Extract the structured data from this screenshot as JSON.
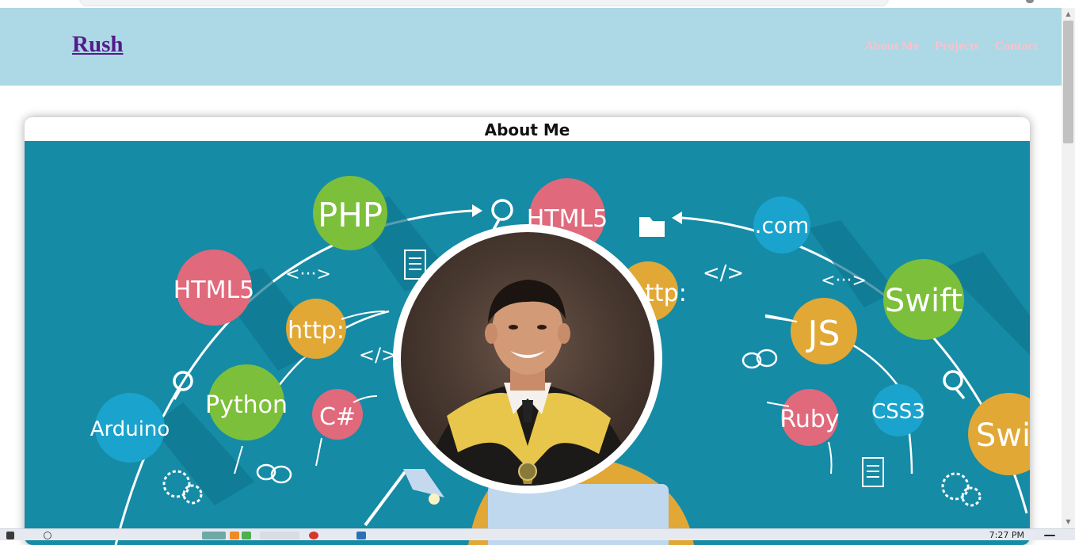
{
  "site": {
    "logo": "Rush",
    "nav": [
      "About Me",
      "Projects",
      "Contact"
    ]
  },
  "about": {
    "title": "About Me"
  },
  "banner": {
    "bubbles": [
      "PHP",
      "HTML5",
      "HTML5",
      "http:",
      "http:",
      "Python",
      "C#",
      "Arduino",
      ".com",
      "Swift",
      "JS",
      "Ruby",
      "CSS3",
      "Swift"
    ],
    "symbols": [
      "<···>",
      "</>",
      "</>",
      "<···>"
    ]
  },
  "taskbar": {
    "clock": "7:27 PM"
  },
  "colors": {
    "header_bg": "#add8e6",
    "logo": "#551a8b",
    "nav": "#ffc0cb",
    "banner_bg": "#158ba6",
    "bubble_red": "#e0697c",
    "bubble_green": "#7cbf3a",
    "bubble_orange": "#e1a836",
    "bubble_blue": "#1aa3cc"
  },
  "icons": [
    "search-icon",
    "document-icon",
    "folder-icon",
    "chat-bubbles-icon",
    "gears-icon",
    "windows-start-icon"
  ]
}
